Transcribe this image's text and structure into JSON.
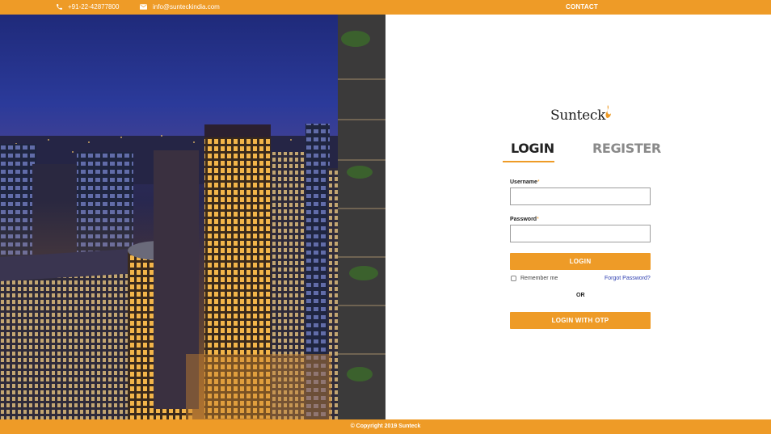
{
  "topbar": {
    "phone": "+91-22-42877800",
    "email": "info@sunteckindia.com",
    "contact_label": "CONTACT",
    "phone_icon": "phone-icon",
    "email_icon": "mail-icon"
  },
  "hero": {
    "description_icon": "city-skyline-image"
  },
  "logo": {
    "text": "Sunteck"
  },
  "tabs": [
    {
      "label": "LOGIN",
      "active": true
    },
    {
      "label": "REGISTER",
      "active": false
    }
  ],
  "form": {
    "username_label": "Username",
    "username_value": "",
    "password_label": "Password",
    "password_value": "",
    "required_marker": "*",
    "login_button": "LOGIN",
    "remember_label": "Remember me",
    "remember_checked": false,
    "forgot_label": "Forgot Password?",
    "or_label": "OR",
    "otp_button": "LOGIN WITH OTP"
  },
  "footer": {
    "copyright": "© Copyright 2019 Sunteck"
  },
  "colors": {
    "accent": "#ee9b27",
    "link": "#2f3fb0"
  }
}
